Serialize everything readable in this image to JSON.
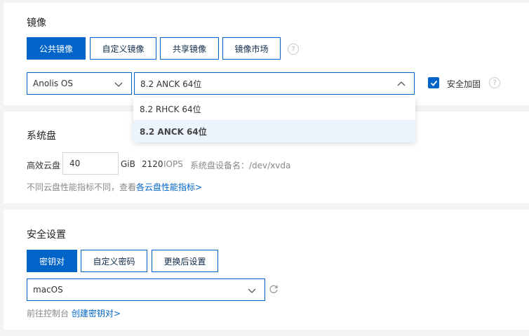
{
  "image": {
    "title": "镜像",
    "tabs": [
      "公共镜像",
      "自定义镜像",
      "共享镜像",
      "镜像市场"
    ],
    "os_select": "Anolis OS",
    "version_select": "8.2 ANCK 64位",
    "hardening_label": "安全加固",
    "dropdown_options": [
      "8.2 RHCK 64位",
      "8.2 ANCK 64位"
    ]
  },
  "disk": {
    "title": "系统盘",
    "type_label": "高效云盘",
    "size_value": "40",
    "unit": "GiB",
    "iops_value": "2120",
    "iops_unit": "IOPS",
    "device_label": "系统盘设备名：/dev/xvda",
    "note_prefix": "不同云盘性能指标不同，查看",
    "note_link": "各云盘性能指标>"
  },
  "security": {
    "title": "安全设置",
    "tabs": [
      "密钥对",
      "自定义密码",
      "更换后设置"
    ],
    "keypair_select": "macOS",
    "note_prefix": "前往控制台",
    "note_link": "创建密钥对>"
  },
  "colors": {
    "accent": "#0064c8",
    "page_bg": "#f2f3f5",
    "selected_row": "#ebf3fc"
  },
  "icons": [
    "help-icon",
    "chevron-down-icon",
    "chevron-up-icon",
    "check-icon",
    "refresh-icon"
  ]
}
